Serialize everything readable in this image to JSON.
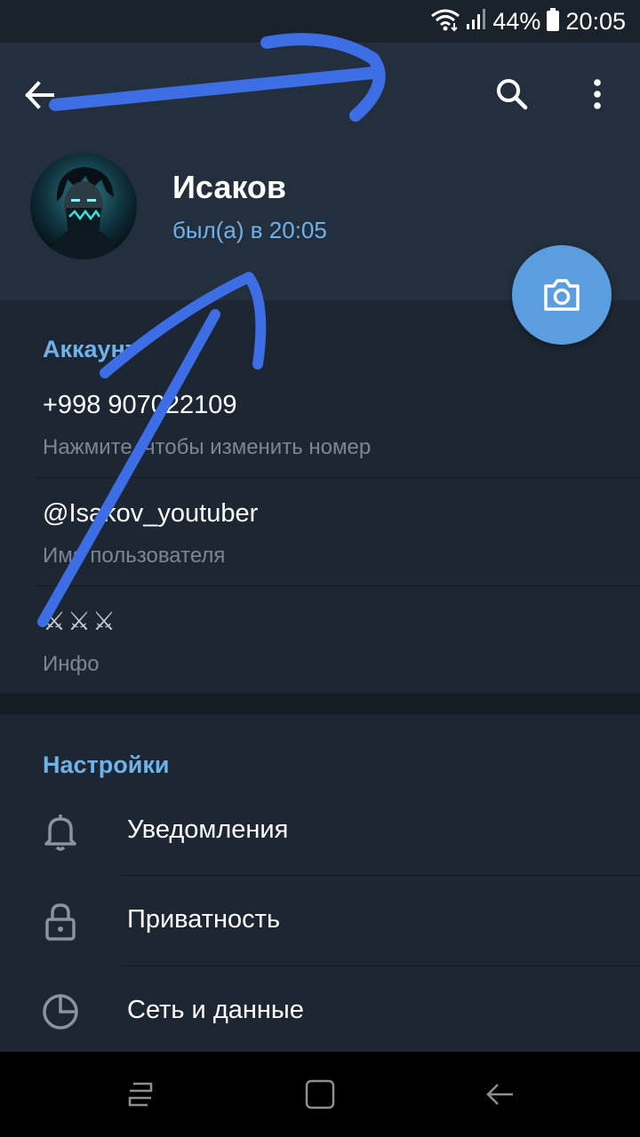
{
  "status_bar": {
    "battery_percent": "44%",
    "time": "20:05",
    "icons": [
      "wifi-icon",
      "signal-icon",
      "battery-icon"
    ]
  },
  "header": {
    "back_icon": "arrow-left-icon",
    "search_icon": "search-icon",
    "menu_icon": "more-vertical-icon"
  },
  "profile": {
    "name": "Исаков",
    "status": "был(а) в 20:05",
    "avatar_icon": "avatar-image",
    "camera_icon": "camera-icon"
  },
  "account": {
    "title": "Аккаунт",
    "phone": "+998 907022109",
    "phone_hint": "Нажмите, чтобы изменить номер",
    "username": "@Isakov_youtuber",
    "username_hint": "Имя пользователя",
    "bio": "⚔⚔⚔",
    "bio_hint": "Инфо"
  },
  "settings": {
    "title": "Настройки",
    "items": [
      {
        "label": "Уведомления",
        "icon": "bell-icon"
      },
      {
        "label": "Приватность",
        "icon": "lock-icon"
      },
      {
        "label": "Сеть и данные",
        "icon": "clock-pie-icon"
      }
    ]
  },
  "nav_bar": {
    "icons": [
      "recent-apps-icon",
      "home-icon",
      "back-icon"
    ]
  },
  "colors": {
    "header_bg": "#242f3d",
    "page_bg": "#1d2733",
    "accent": "#6fb2ea",
    "fab": "#5a9ee0",
    "annotation_stroke": "#3d6ee6"
  }
}
